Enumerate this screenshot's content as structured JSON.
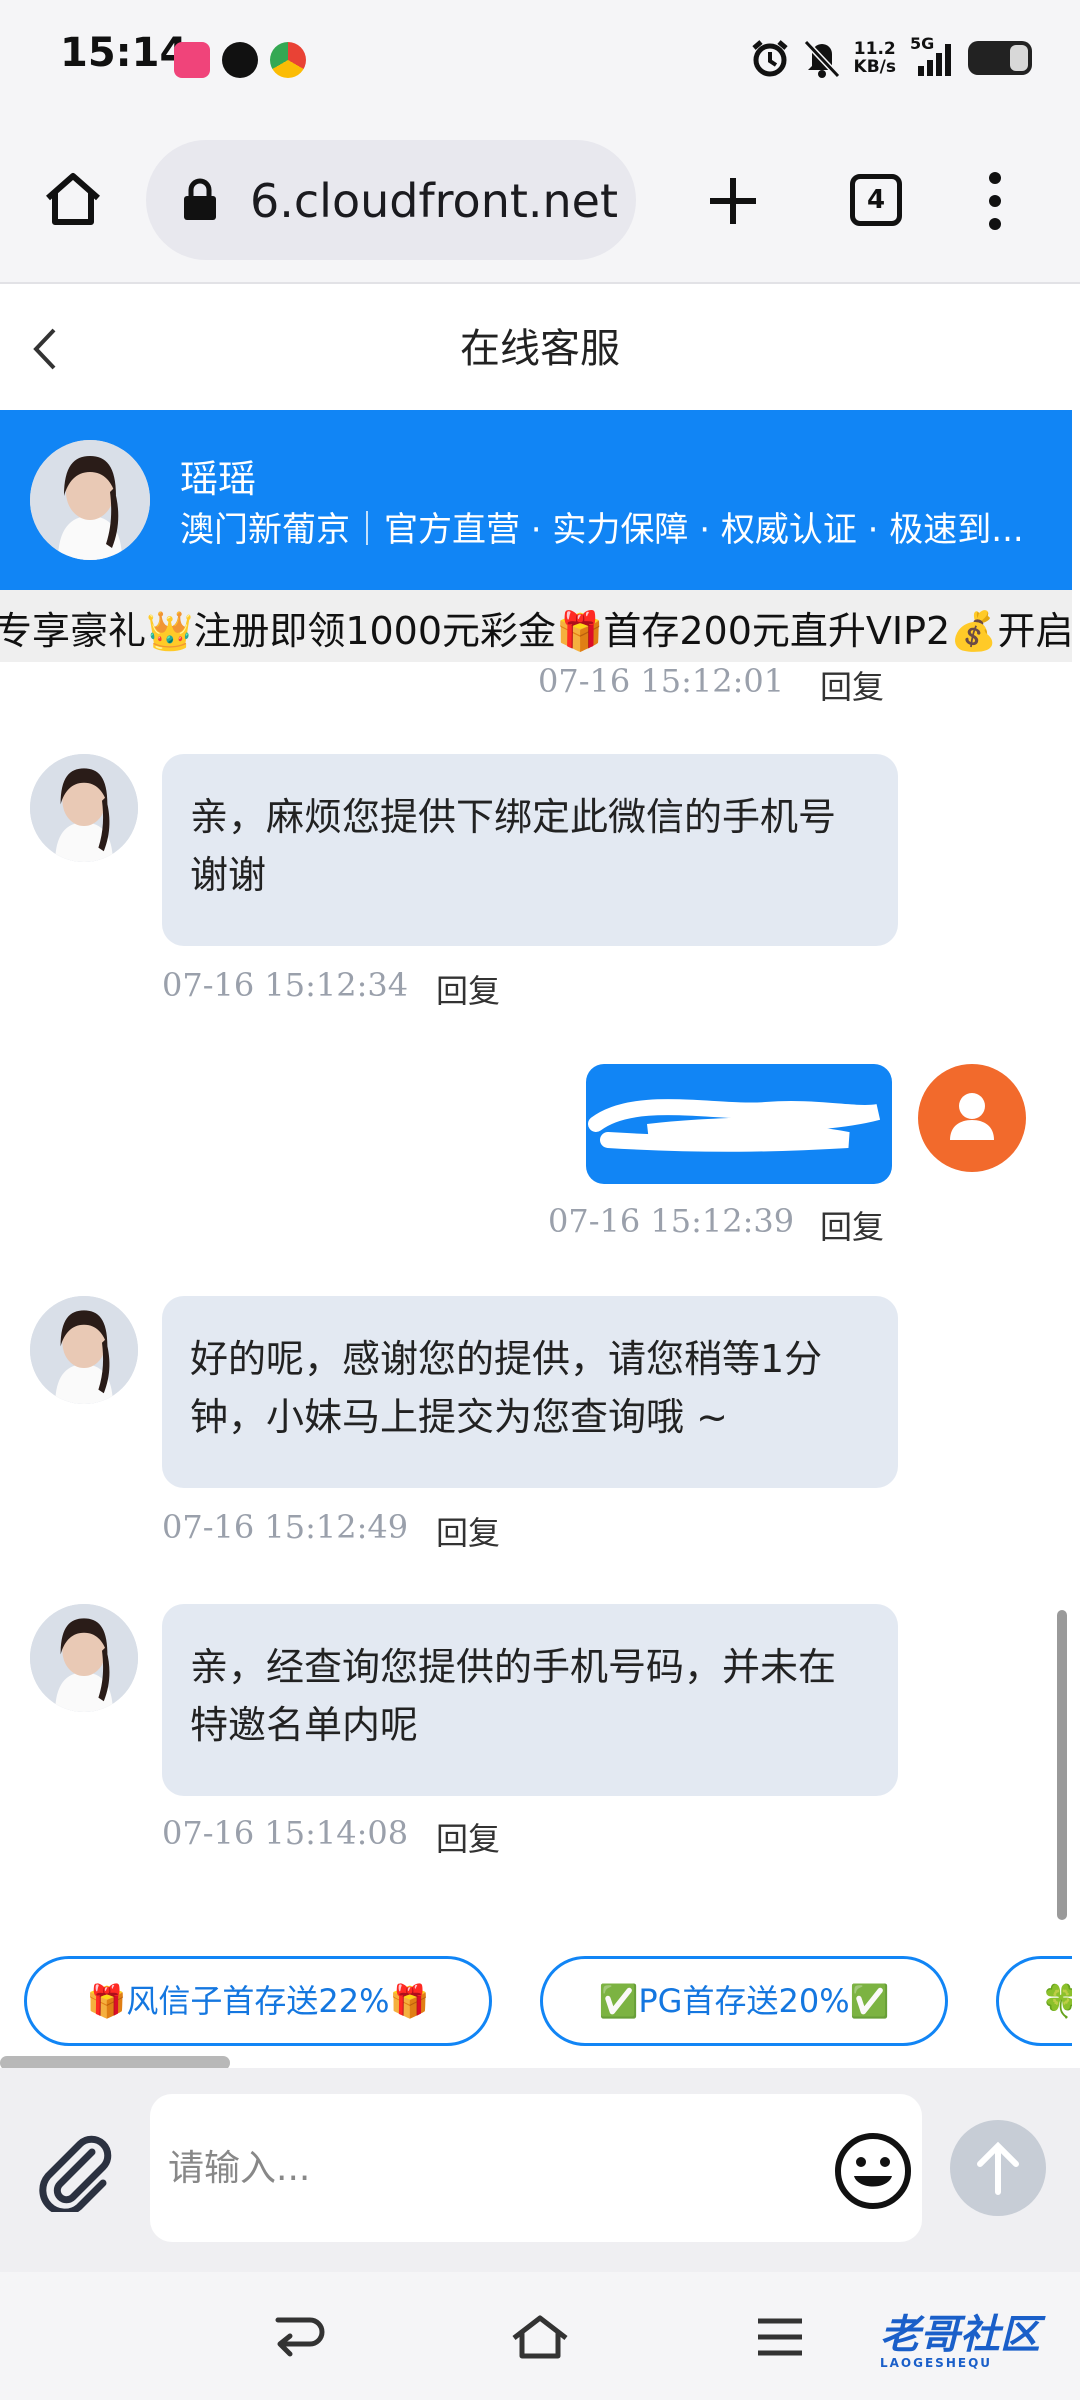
{
  "status_bar": {
    "time": "15:14",
    "net_speed_value": "11.2",
    "net_speed_unit": "KB/s",
    "network": "5G"
  },
  "browser": {
    "url": "6.cloudfront.net",
    "tab_count": "4"
  },
  "page": {
    "title": "在线客服"
  },
  "agent": {
    "name": "瑶瑶",
    "description": "澳门新葡京｜官方直营 · 实力保障 · 权威认证 · 极速到..."
  },
  "marquee": {
    "text": "专享豪礼👑注册即领1000元彩金🎁首存200元直升VIP2💰开启"
  },
  "messages": [
    {
      "type": "meta",
      "time": "07-16 15:12:01",
      "reply": "回复"
    },
    {
      "type": "incoming",
      "text": "亲，麻烦您提供下绑定此微信的手机号 谢谢",
      "time": "07-16 15:12:34",
      "reply": "回复"
    },
    {
      "type": "outgoing",
      "text": "",
      "time": "07-16 15:12:39",
      "reply": "回复"
    },
    {
      "type": "incoming",
      "text": "好的呢，感谢您的提供，请您稍等1分钟，小妹马上提交为您查询哦 ~",
      "time": "07-16 15:12:49",
      "reply": "回复"
    },
    {
      "type": "incoming",
      "text": "亲，经查询您提供的手机号码，并未在特邀名单内呢",
      "time": "07-16 15:14:08",
      "reply": "回复"
    }
  ],
  "quick_replies": [
    "🎁风信子首存送22%🎁",
    "✅PG首存送20%✅",
    "🍀"
  ],
  "input": {
    "placeholder": "请输入..."
  },
  "watermark": {
    "text": "老哥社区",
    "sub": "LAOGESHEQU"
  },
  "colors": {
    "brand_blue": "#1185f5",
    "bubble_bg": "#e3e9f2",
    "user_avatar": "#f26a2c",
    "timestamp": "#9aa0ab"
  },
  "icons": [
    "alarm-icon",
    "mute-icon",
    "signal-icon",
    "battery-icon",
    "home-icon",
    "lock-icon",
    "plus-icon",
    "more-icon",
    "back-icon",
    "paperclip-icon",
    "emoji-icon",
    "send-icon",
    "nav-back-icon",
    "nav-home-icon",
    "nav-menu-icon"
  ]
}
